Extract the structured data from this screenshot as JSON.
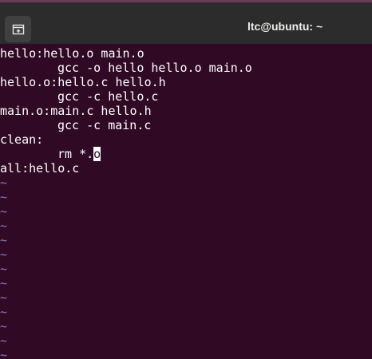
{
  "window": {
    "title": "ltc@ubuntu: ~"
  },
  "icons": {
    "new_tab": "new-tab-icon"
  },
  "editor": {
    "lines": [
      {
        "indent": false,
        "text": "hello:hello.o main.o"
      },
      {
        "indent": true,
        "text": "gcc -o hello hello.o main.o"
      },
      {
        "indent": false,
        "text": "hello.o:hello.c hello.h"
      },
      {
        "indent": true,
        "text": "gcc -c hello.c"
      },
      {
        "indent": false,
        "text": "main.o:main.c hello.h"
      },
      {
        "indent": true,
        "text": "gcc -c main.c"
      },
      {
        "indent": false,
        "text": "clean:"
      },
      {
        "indent": true,
        "text": "rm *.",
        "cursor_char": "o"
      },
      {
        "indent": false,
        "text": "all:hello.c"
      }
    ],
    "empty_line_marker": "~",
    "empty_line_count": 13
  },
  "colors": {
    "background": "#300a24",
    "text": "#ffffff",
    "tilde": "#8a74c8",
    "titlebar": "#2c2c2c"
  }
}
